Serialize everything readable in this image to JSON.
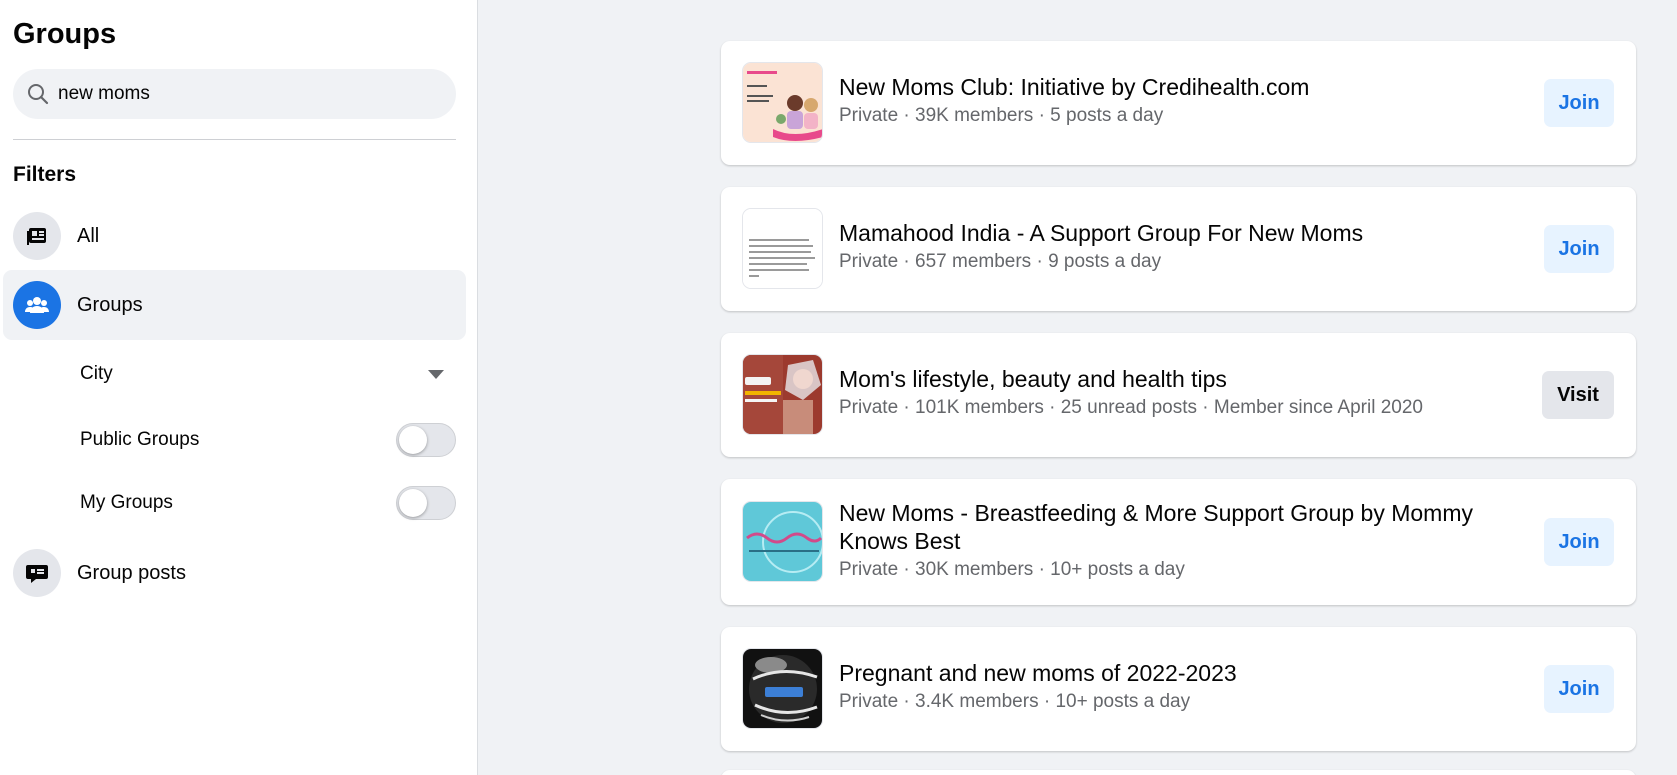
{
  "sidebar": {
    "title": "Groups",
    "search": {
      "value": "new moms",
      "placeholder": "Search groups"
    },
    "filters_title": "Filters",
    "items": [
      {
        "label": "All",
        "icon": "feed-icon"
      },
      {
        "label": "Groups",
        "icon": "groups-icon",
        "active": true
      },
      {
        "label": "Group posts",
        "icon": "post-bubble-icon"
      }
    ],
    "sub_filters": {
      "city": {
        "label": "City"
      },
      "public_groups": {
        "label": "Public Groups",
        "on": false
      },
      "my_groups": {
        "label": "My Groups",
        "on": false
      }
    }
  },
  "results": [
    {
      "title": "New Moms Club: Initiative by Credihealth.com",
      "meta": "Private · 39K members · 5 posts a day",
      "button": "Join"
    },
    {
      "title": "Mamahood India - A Support Group For New Moms",
      "meta": "Private · 657 members · 9 posts a day",
      "button": "Join"
    },
    {
      "title": "Mom's lifestyle, beauty and health tips",
      "meta": "Private · 101K members · 25 unread posts · Member since April 2020",
      "button": "Visit"
    },
    {
      "title": "New Moms - Breastfeeding & More Support Group by Mommy Knows Best",
      "meta": "Private · 30K members · 10+ posts a day",
      "button": "Join"
    },
    {
      "title": "Pregnant and new moms of 2022-2023",
      "meta": "Private · 3.4K members · 10+ posts a day",
      "button": "Join"
    }
  ],
  "colors": {
    "accent": "#1b74e4",
    "join_bg": "#e7f3ff",
    "page_bg": "#f0f2f5",
    "muted_text": "#65676b"
  }
}
